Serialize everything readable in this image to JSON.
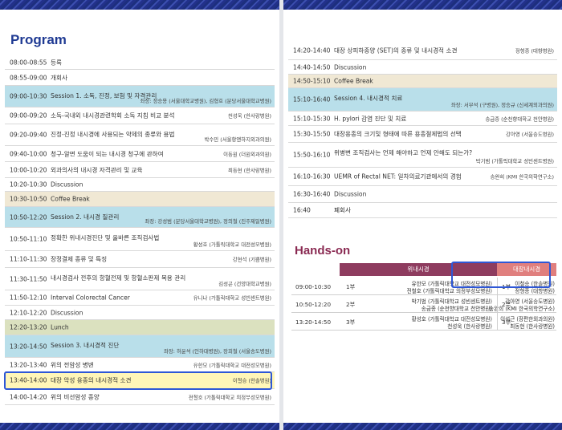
{
  "program_title": "Program",
  "handson_title": "Hands-on",
  "program_rows": [
    {
      "time": "08:00-08:55",
      "title": "등록",
      "speaker": ""
    },
    {
      "time": "08:55-09:00",
      "title": "개회사",
      "speaker": ""
    },
    {
      "time": "09:00-10:30",
      "title": "Session 1. 소독, 진정, 보험 및 자격관리",
      "speaker": "좌장: 정승용 (서울대학교병원), 김형호 (분당서울대학교병원)"
    },
    {
      "time": "09:00-09:20",
      "title": "소독-국내외 내시경관련학회 소독 지침 비교 분석",
      "speaker": "천성욱 (한사랑병원)"
    },
    {
      "time": "09:20-09:40",
      "title": "진정-진정 내시경에 사용되는 약제의 종류와 용법",
      "speaker": "박수민 (서울항앤하지외과의원)"
    },
    {
      "time": "09:40-10:00",
      "title": "청구-알면 도움이 되는 내시경 청구에 관하여",
      "speaker": "이동원 (더원외과의원)"
    },
    {
      "time": "10:00-10:20",
      "title": "외과의사의 내시경 자격관리 및 교육",
      "speaker": "최동현 (한사랑병원)"
    },
    {
      "time": "10:20-10:30",
      "title": "Discussion",
      "speaker": ""
    },
    {
      "time": "10:30-10:50",
      "title": "Coffee Break",
      "speaker": ""
    },
    {
      "time": "10:50-12:20",
      "title": "Session 2. 내시경 질관리",
      "speaker": "좌장: 강성범 (분당서울대학교병원), 정의철 (진주제일병원)"
    },
    {
      "time": "10:50-11:10",
      "title": "정확한 위내시경진단 및 올바른 조직검사법",
      "speaker": "황성호 (가톨릭대학교 대전성모병원)"
    },
    {
      "time": "11:10-11:30",
      "title": "장정결제 종류 및 특징",
      "speaker": "강현석 (기쁨병원)"
    },
    {
      "time": "11:30-11:50",
      "title": "내시경검사 전후의 항혈전제 및 항혈소판제 복용 관리",
      "speaker": "김성곤 (건양대학교병원)"
    },
    {
      "time": "11:50-12:10",
      "title": "Interval Colorectal Cancer",
      "speaker": "유니나 (가톨릭대학교 성빈센트병원)"
    },
    {
      "time": "12:10-12:20",
      "title": "Discussion",
      "speaker": ""
    },
    {
      "time": "12:20-13:20",
      "title": "Lunch",
      "speaker": ""
    },
    {
      "time": "13:20-14:50",
      "title": "Session 3. 내시경적 진단",
      "speaker": "좌장: 허윤석 (인하대병원), 장희철 (서울송도병원)"
    },
    {
      "time": "13:20-13:40",
      "title": "위의 전암성 병변",
      "speaker": "유한모 (가톨릭대학교 대전성모병원)"
    },
    {
      "time": "13:40-14:00",
      "title": "대장 악성 용종의 내시경적 소견",
      "speaker": "이철승 (한솔병원)"
    },
    {
      "time": "14:00-14:20",
      "title": "위의 비선암성 종양",
      "speaker": "전철호 (가톨릭대학교 의정부성모병원)"
    }
  ],
  "right_rows": [
    {
      "time": "14:20-14:40",
      "title": "대장 상피하종양 (SET)의 종류 및 내시경적 소견",
      "speaker": "정형종 (대항병원)"
    },
    {
      "time": "14:40-14:50",
      "title": "Discussion",
      "speaker": ""
    },
    {
      "time": "14:50-15:10",
      "title": "Coffee Break",
      "speaker": ""
    },
    {
      "time": "15:10-16:40",
      "title": "Session 4. 내시경적 치료",
      "speaker": "좌장: 서무석 (구병원), 정승규 (신세계외과의원)"
    },
    {
      "time": "15:10-15:30",
      "title": "H. pylori 감염 진단 및 치료",
      "speaker": "송금종 (순천향대학교 천안병원)"
    },
    {
      "time": "15:30-15:50",
      "title": "대장용종의 크기및 형태에 따른 용종절제법의 선택",
      "speaker": "강아영 (서울송도병원)"
    },
    {
      "time": "15:50-16:10",
      "title": "위병변 조직검사는 언제 해야하고 언제 안해도 되는가?",
      "speaker": "박기범 (가톨릭대학교 성빈센트병원)"
    },
    {
      "time": "16:10-16:30",
      "title": "UEMR of Rectal NET: 일차의료기관에서의 경험",
      "speaker": "송완희 (KMI 한국의학연구소)"
    },
    {
      "time": "16:30-16:40",
      "title": "Discussion",
      "speaker": ""
    },
    {
      "time": "16:40",
      "title": "폐회사",
      "speaker": ""
    }
  ],
  "handson": {
    "headers": {
      "upper": "위내시경",
      "lower": "대장내시경"
    },
    "rows": [
      {
        "time": "09:00-10:30",
        "part_a": "1부",
        "upper": [
          "유한모 (가톨릭대학교 대전성모병원)",
          "전철호 (가톨릭대학교 의정부성모병원)"
        ],
        "part_b": "1부",
        "lower": [
          "이철승 (한솔병원)",
          "정형종 (대항병원)"
        ]
      },
      {
        "time": "10:50-12:20",
        "part_a": "2부",
        "upper": [
          "박기범 (가톨릭대학교 성빈센트병원)",
          "송금종 (순천향대학교 천안병원)"
        ],
        "part_b": "2부",
        "lower": [
          "강아영 (서울송도병원)",
          "송완희 (KMI 한국의학연구소)"
        ]
      },
      {
        "time": "13:20-14:50",
        "part_a": "3부",
        "upper": [
          "황성호 (가톨릭대학교 대전성모병원)",
          "천성욱 (한사랑병원)"
        ],
        "part_b": "3부",
        "lower": [
          "이성근 (장편한외과의원)",
          "최동현 (한사랑병원)"
        ]
      }
    ]
  },
  "colors": {
    "title_blue": "#1f3a93",
    "hands_title": "#8a2a52",
    "highlight": "#2e57d6",
    "upper_header": "#8e3c5f",
    "lower_header": "#e07f7e"
  }
}
